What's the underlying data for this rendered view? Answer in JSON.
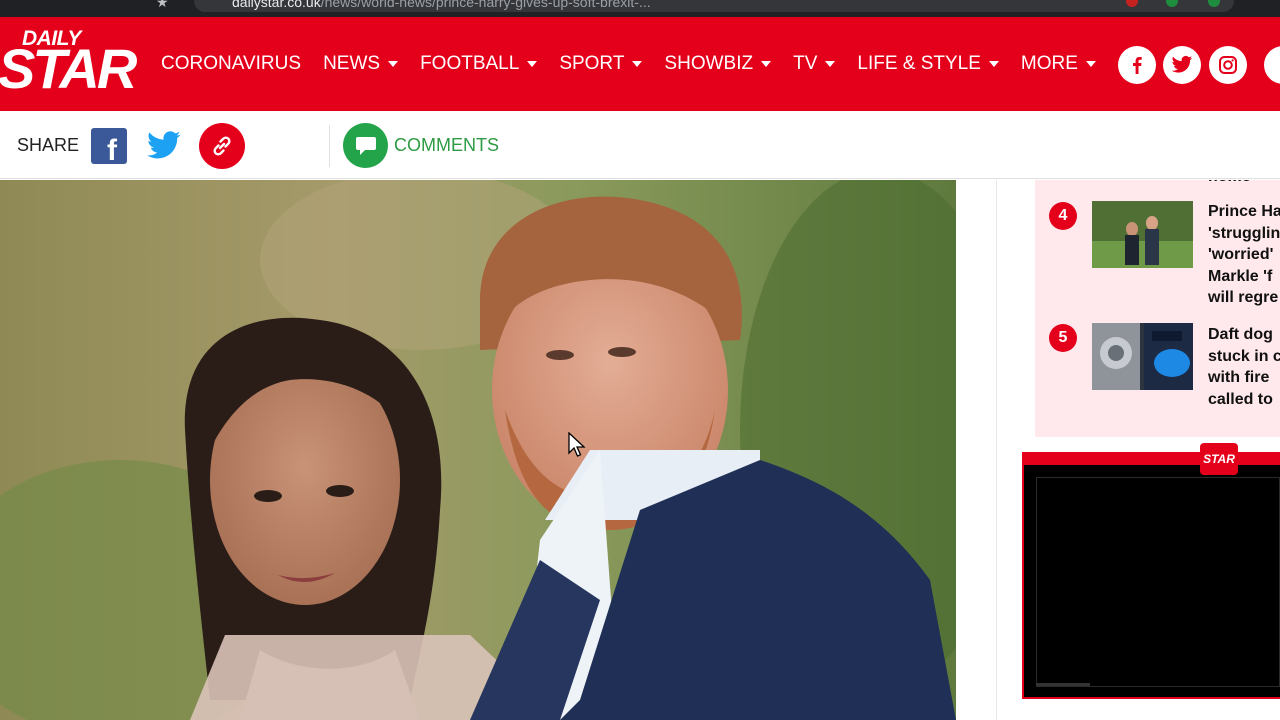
{
  "browser": {
    "url_domain": "dailystar.co.uk",
    "url_path": "/news/world-news/prince-harry-gives-up-soft-brexit-..."
  },
  "logo": {
    "line1": "DAILY",
    "line2": "STAR"
  },
  "nav": {
    "items": [
      {
        "label": "CORONAVIRUS",
        "has_caret": false
      },
      {
        "label": "NEWS",
        "has_caret": true
      },
      {
        "label": "FOOTBALL",
        "has_caret": true
      },
      {
        "label": "SPORT",
        "has_caret": true
      },
      {
        "label": "SHOWBIZ",
        "has_caret": true
      },
      {
        "label": "TV",
        "has_caret": true
      },
      {
        "label": "LIFE & STYLE",
        "has_caret": true
      },
      {
        "label": "MORE",
        "has_caret": true
      }
    ],
    "social_icons": [
      "facebook-icon",
      "twitter-icon",
      "instagram-icon"
    ]
  },
  "share": {
    "label": "SHARE",
    "comments_label": "COMMENTS"
  },
  "trending": {
    "previous_tail": "home",
    "items": [
      {
        "rank": "4",
        "lines": [
          "Prince Ha",
          "'strugglin",
          "'worried'",
          "Markle 'f",
          "will regre"
        ]
      },
      {
        "rank": "5",
        "lines": [
          "Daft dog",
          "stuck in c",
          "with fire",
          "called to"
        ]
      }
    ]
  },
  "video": {
    "logo_text": "STAR"
  },
  "colors": {
    "brand_red": "#e4001b",
    "comment_green": "#24a44a",
    "facebook_blue": "#3b5998",
    "twitter_blue": "#1da1f2",
    "trending_bg": "#ffe9ec"
  }
}
